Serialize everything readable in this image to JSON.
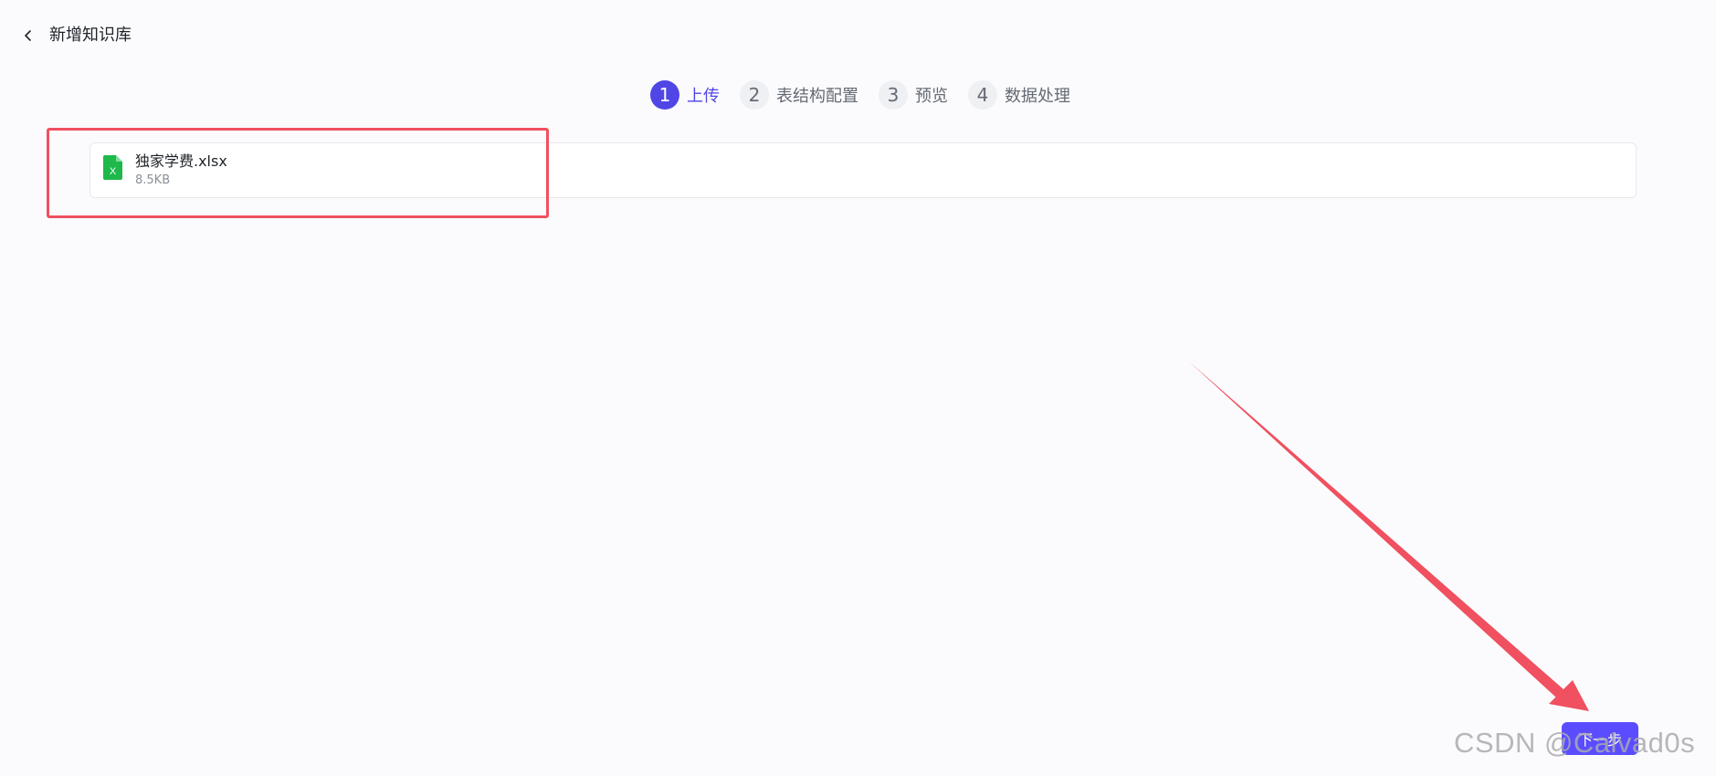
{
  "header": {
    "back_icon": "chevron-left-icon",
    "title": "新增知识库"
  },
  "steps": [
    {
      "number": "1",
      "label": "上传",
      "active": true
    },
    {
      "number": "2",
      "label": "表结构配置",
      "active": false
    },
    {
      "number": "3",
      "label": "预览",
      "active": false
    },
    {
      "number": "4",
      "label": "数据处理",
      "active": false
    }
  ],
  "file": {
    "icon": "excel-file-icon",
    "icon_letter": "X",
    "name": "独家学费.xlsx",
    "size": "8.5KB"
  },
  "actions": {
    "next_label": "下一步"
  },
  "watermark": {
    "text": "CSDN @Calvad0s"
  },
  "colors": {
    "accent": "#4f46e5",
    "button": "#5b4dff",
    "annotation": "#f0505f",
    "excel_green": "#1fb84b"
  }
}
